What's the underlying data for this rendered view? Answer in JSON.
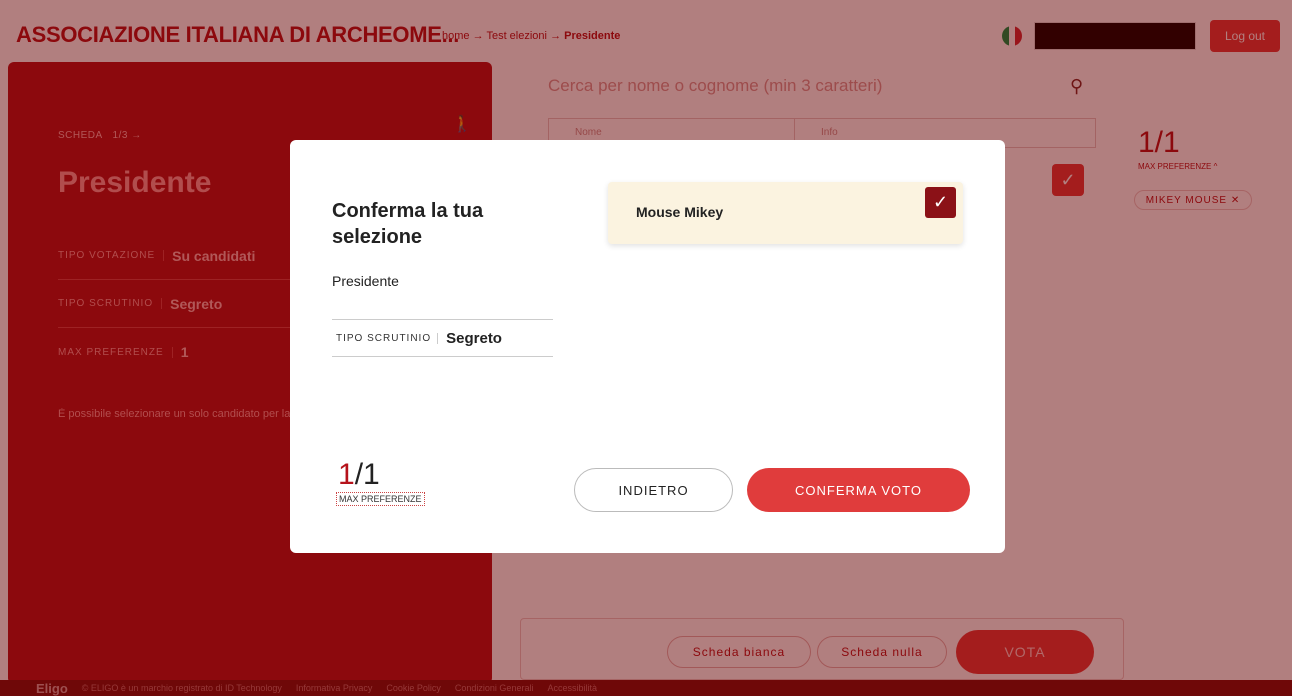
{
  "header": {
    "brand": "ASSOCIAZIONE ITALIANA DI ARCHEOME...",
    "breadcrumb": {
      "home": "home",
      "sep": "→",
      "election": "Test elezioni",
      "current": "Presidente"
    },
    "logout_label": "Log out",
    "flag_colors": [
      "#009246",
      "#ffffff",
      "#ce2b37"
    ]
  },
  "left": {
    "scheda_label": "SCHEDA",
    "scheda_page": "1/3",
    "arrow": "→",
    "title": "Presidente",
    "meta": [
      {
        "label": "TIPO VOTAZIONE",
        "value": "Su candidati"
      },
      {
        "label": "TIPO SCRUTINIO",
        "value": "Segreto"
      },
      {
        "label": "MAX PREFERENZE",
        "value": "1"
      }
    ],
    "hint": "È possibile selezionare un solo candidato per la"
  },
  "search": {
    "placeholder": "Cerca per nome o cognome (min 3 caratteri)"
  },
  "table": {
    "col_name": "Nome",
    "col_info": "Info"
  },
  "right": {
    "count": "1/1",
    "max_pref_label": "MAX PREFERENZE",
    "chevron": "^",
    "chip_label": "MIKEY MOUSE",
    "chip_close": "✕"
  },
  "actions": {
    "blank": "Scheda bianca",
    "null": "Scheda nulla",
    "vote": "VOTA"
  },
  "footer": {
    "logo": "Eligo",
    "items": [
      "© ELIGO è un marchio registrato di ID Technology",
      "Informativa Privacy",
      "Cookie Policy",
      "Condizioni Generali",
      "Accessibilità"
    ]
  },
  "modal": {
    "title": "Conferma la tua selezione",
    "subtitle": "Presidente",
    "row_label": "TIPO SCRUTINIO",
    "row_value": "Segreto",
    "candidate_name": "Mouse Mikey",
    "check_glyph": "✓",
    "count_current": "1",
    "count_total": "/1",
    "max_pref_label": "MAX PREFERENZE",
    "back_label": "INDIETRO",
    "confirm_label": "CONFERMA VOTO"
  }
}
